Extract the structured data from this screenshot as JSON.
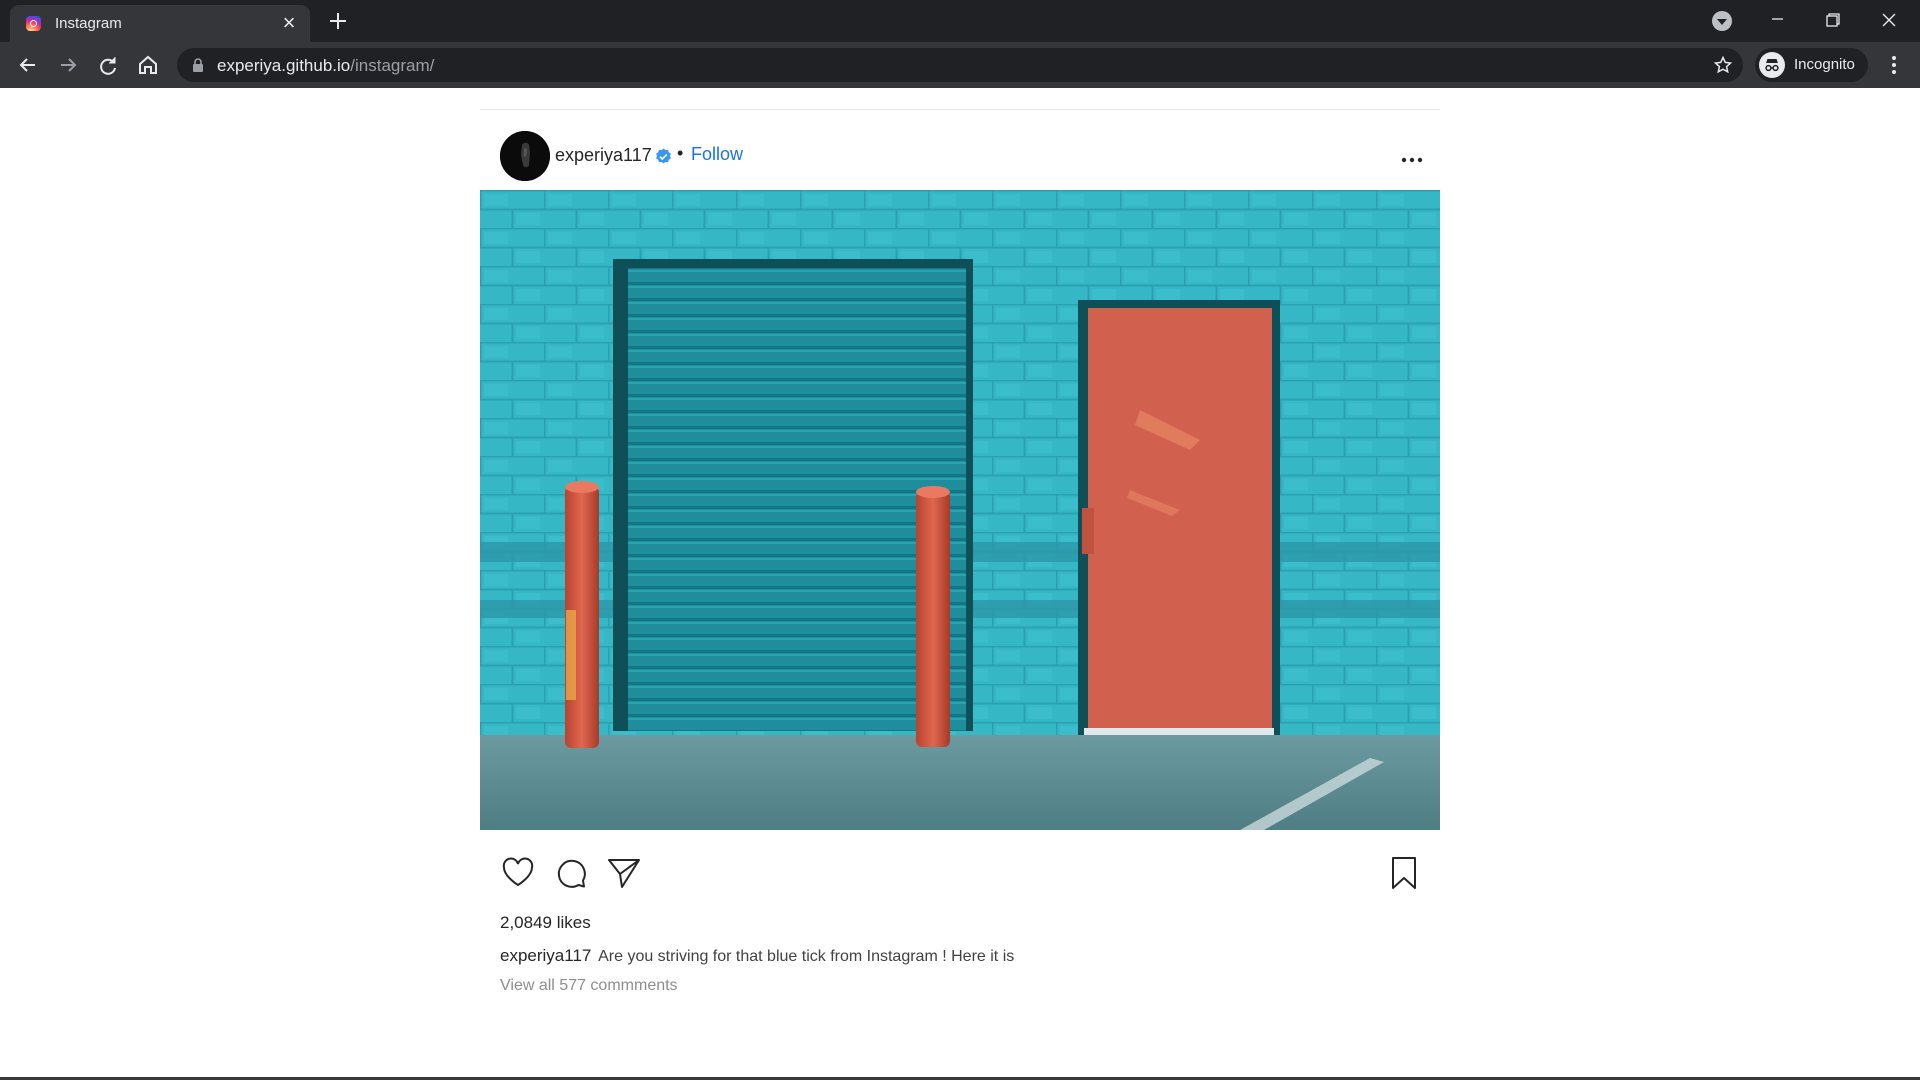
{
  "browser": {
    "tab_title": "Instagram",
    "url_host": "experiya.github.io",
    "url_path": "/instagram/",
    "profile_label": "Incognito"
  },
  "post": {
    "username": "experiya117",
    "separator": "•",
    "follow_label": "Follow",
    "image_alt": "Teal brick wall with a rolling shutter door, two red bollards and a coral door",
    "likes": "2,0849 likes",
    "caption_user": "experiya117",
    "caption_text": "Are you striving for that blue tick from Instagram ! Here it is",
    "comments_link": "View all 577 commments"
  },
  "colors": {
    "accent": "#1a73e8",
    "verified": "#3897f0",
    "wall": "#33b5c4",
    "door": "#d2604f",
    "chrome_dark": "#202124"
  },
  "icons": {
    "like": "heart-icon",
    "comment": "comment-icon",
    "share": "share-icon",
    "save": "bookmark-icon",
    "more": "more-options-icon"
  }
}
